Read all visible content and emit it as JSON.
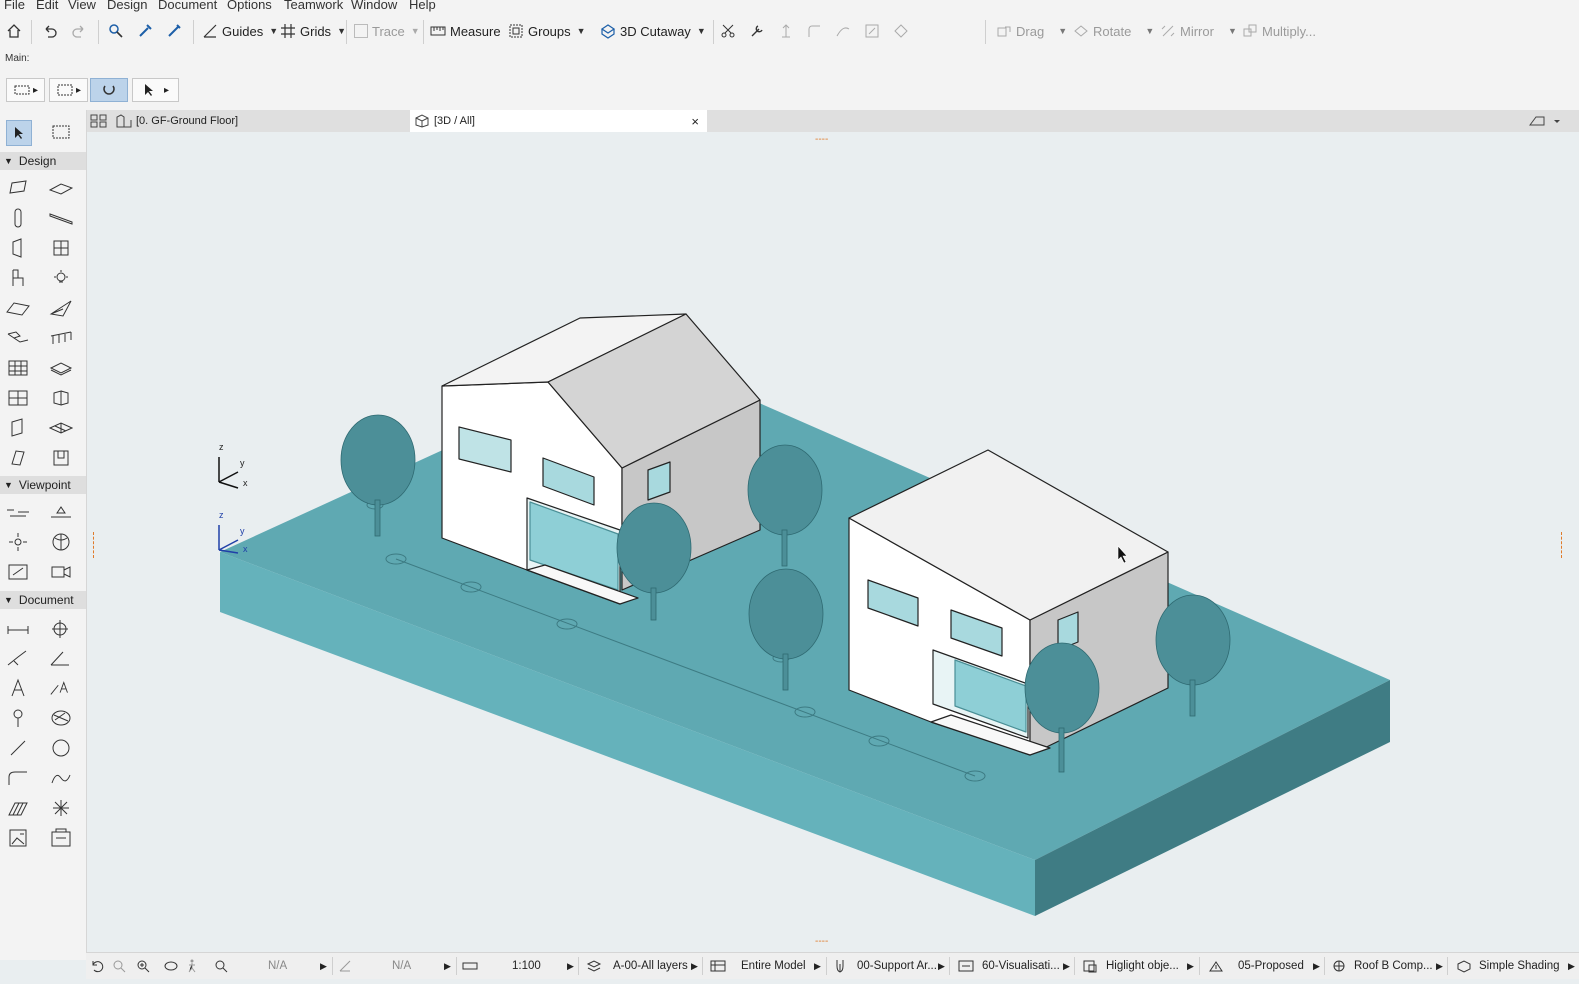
{
  "menu": [
    "File",
    "Edit",
    "View",
    "Design",
    "Document",
    "Options",
    "Teamwork",
    "Window",
    "Help"
  ],
  "toolbar": {
    "guides": "Guides",
    "grids": "Grids",
    "trace": "Trace",
    "measure": "Measure",
    "groups": "Groups",
    "cutaway": "3D Cutaway",
    "drag": "Drag",
    "rotate": "Rotate",
    "mirror": "Mirror",
    "multiply": "Multiply..."
  },
  "main_label": "Main:",
  "tabs": {
    "floorplan": "[0. GF-Ground Floor]",
    "view3d": "[3D / All]",
    "close": "×"
  },
  "toolbox": {
    "design": "Design",
    "viewpoint": "Viewpoint",
    "document": "Document"
  },
  "axes": {
    "z": "z",
    "y": "y",
    "x": "x"
  },
  "edge_marks": "----",
  "status": {
    "na1": "N/A",
    "na2": "N/A",
    "scale": "1:100",
    "layers": "A-00-All layers",
    "model": "Entire Model",
    "pen": "00-Support Ar...",
    "mvo": "60-Visualisati...",
    "highlight": "Higlight obje...",
    "renovation": "05-Proposed",
    "roof": "Roof B Comp...",
    "shading": "Simple Shading"
  },
  "colors": {
    "ground_top": "#5fa9b2",
    "ground_left": "#65b2bb",
    "ground_right": "#3f7c84",
    "tree": "#4c8f98",
    "accent_edge": "#e07a2a"
  }
}
